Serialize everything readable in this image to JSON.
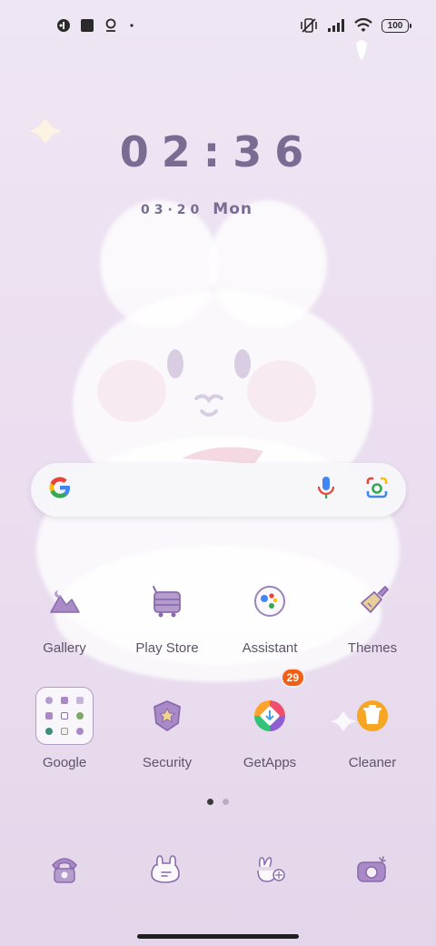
{
  "status_bar": {
    "icons_left": [
      "mi-icon",
      "square-icon",
      "assistant-icon",
      "dot"
    ],
    "icons_right": [
      "vibrate-off-icon",
      "signal-icon",
      "wifi-icon"
    ],
    "battery": "100"
  },
  "clock": {
    "time": "02:36"
  },
  "date": {
    "digits": "03·20",
    "weekday": "Mon"
  },
  "search": {
    "mic": "voice-search",
    "lens": "lens-search"
  },
  "apps": {
    "gallery": "Gallery",
    "play_store": "Play Store",
    "assistant": "Assistant",
    "themes": "Themes",
    "google": "Google",
    "security": "Security",
    "getapps": "GetApps",
    "getapps_badge": "29",
    "cleaner": "Cleaner"
  },
  "colors": {
    "icon_purple": "#9b84b8",
    "text": "#5e5369",
    "badge": "#f35e15",
    "dot_active": "#3a3a3a",
    "dot_inactive": "#b9adc6"
  },
  "dock": [
    "phone-icon",
    "messages-icon",
    "browser-icon",
    "camera-icon"
  ]
}
